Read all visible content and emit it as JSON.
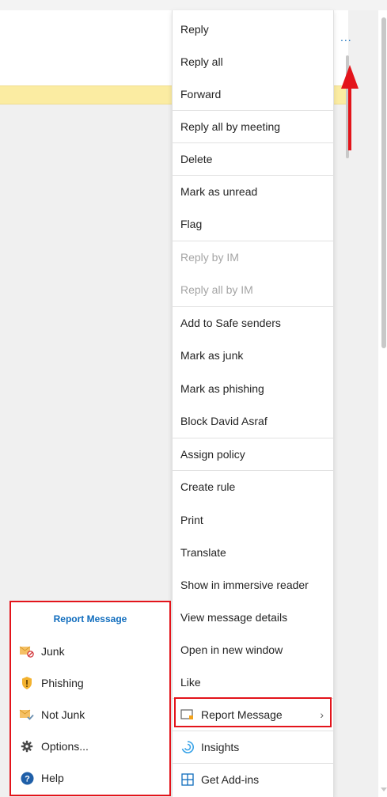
{
  "header": {
    "more_label": "..."
  },
  "context_menu": {
    "items": [
      {
        "label": "Reply"
      },
      {
        "label": "Reply all"
      },
      {
        "label": "Forward"
      },
      {
        "label": "Reply all by meeting"
      },
      {
        "label": "Delete"
      },
      {
        "label": "Mark as unread"
      },
      {
        "label": "Flag"
      },
      {
        "label": "Reply by IM",
        "disabled": true
      },
      {
        "label": "Reply all by IM",
        "disabled": true
      },
      {
        "label": "Add to Safe senders"
      },
      {
        "label": "Mark as junk"
      },
      {
        "label": "Mark as phishing"
      },
      {
        "label": "Block David Asraf"
      },
      {
        "label": "Assign policy"
      },
      {
        "label": "Create rule"
      },
      {
        "label": "Print"
      },
      {
        "label": "Translate"
      },
      {
        "label": "Show in immersive reader"
      },
      {
        "label": "View message details"
      },
      {
        "label": "Open in new window"
      },
      {
        "label": "Like"
      },
      {
        "label": "Report Message",
        "icon": "report-message-icon",
        "has_submenu": true
      },
      {
        "label": "Insights",
        "icon": "insights-icon"
      },
      {
        "label": "Get Add-ins",
        "icon": "add-ins-grid-icon"
      }
    ]
  },
  "report_submenu": {
    "title": "Report Message",
    "items": [
      {
        "label": "Junk",
        "icon": "junk-envelope-icon"
      },
      {
        "label": "Phishing",
        "icon": "phishing-shield-icon"
      },
      {
        "label": "Not Junk",
        "icon": "not-junk-envelope-icon"
      },
      {
        "label": "Options...",
        "icon": "gear-icon"
      },
      {
        "label": "Help",
        "icon": "help-icon"
      }
    ]
  },
  "colors": {
    "accent": "#0f6cbd",
    "annotation_red": "#e3141b",
    "banner_yellow": "#fbeca2"
  }
}
